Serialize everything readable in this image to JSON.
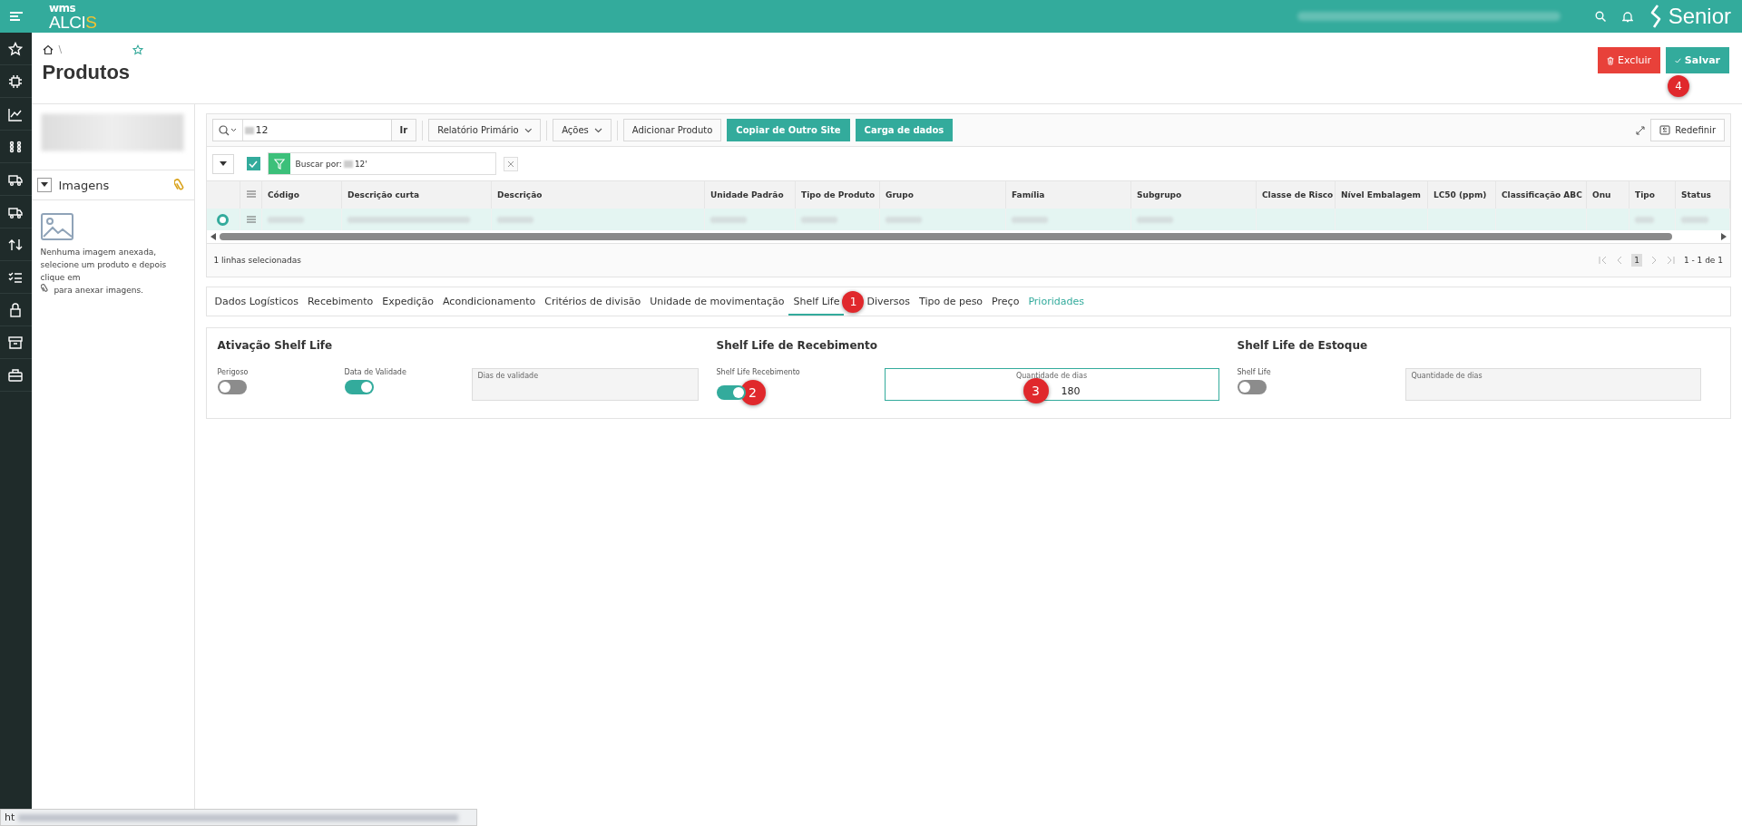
{
  "app": {
    "logo_top": "wms",
    "logo_main": "ALCI",
    "logo_accent": "S",
    "brand": "Senior"
  },
  "breadcrumb_separator": "\\",
  "page_title": "Produtos",
  "actions": [
    {
      "label": "Excluir",
      "kind": "delete"
    },
    {
      "label": "Salvar",
      "kind": "save",
      "callout": "4"
    }
  ],
  "images_panel": {
    "title": "Imagens",
    "expanded": true,
    "message_before": "Nenhuma imagem anexada, selecione um produto e depois clique em",
    "message_after": "para anexar imagens."
  },
  "toolbar": {
    "search_value": "12",
    "go": "Ir",
    "report": "Relatório Primário",
    "actions_menu": "Ações",
    "buttons": [
      {
        "label": "Adicionar Produto",
        "kind": "plain"
      },
      {
        "label": "Copiar de Outro Site",
        "kind": "primary"
      },
      {
        "label": "Carga de dados",
        "kind": "primary"
      }
    ],
    "reset": "Redefinir"
  },
  "filter": {
    "checked": true,
    "label": "Buscar por:",
    "value": "12'"
  },
  "table": {
    "columns": [
      "Código",
      "Descrição curta",
      "Descrição",
      "Unidade Padrão",
      "Tipo de Produto",
      "Grupo",
      "Família",
      "Subgrupo",
      "Classe de Risco",
      "Nível Embalagem",
      "LC50 (ppm)",
      "Classificação ABC",
      "Onu",
      "Tipo",
      "Status"
    ],
    "rows": [
      {
        "selected": true
      }
    ]
  },
  "selection_info": "1 linhas selecionadas",
  "pagination": {
    "page": "1",
    "range": "1 - 1 de 1"
  },
  "tabs": [
    {
      "label": "Dados Logísticos",
      "selected": false,
      "kind": "tab"
    },
    {
      "label": "Recebimento",
      "selected": false,
      "kind": "tab"
    },
    {
      "label": "Expedição",
      "selected": false,
      "kind": "tab"
    },
    {
      "label": "Acondicionamento",
      "selected": false,
      "kind": "tab"
    },
    {
      "label": "Critérios de divisão",
      "selected": false,
      "kind": "tab"
    },
    {
      "label": "Unidade de movimentação",
      "selected": false,
      "kind": "tab"
    },
    {
      "label": "Shelf Life",
      "selected": true,
      "kind": "tab",
      "callout": "1"
    },
    {
      "label": "Diversos",
      "selected": false,
      "kind": "tab"
    },
    {
      "label": "Tipo de peso",
      "selected": false,
      "kind": "tab"
    },
    {
      "label": "Preço",
      "selected": false,
      "kind": "tab"
    },
    {
      "label": "Prioridades",
      "selected": false,
      "kind": "link"
    }
  ],
  "sections": [
    {
      "title": "Ativação Shelf Life",
      "fields": [
        {
          "kind": "toggle",
          "label": "Perigoso",
          "on": false
        },
        {
          "kind": "toggle",
          "label": "Data de Validade",
          "on": true
        },
        {
          "kind": "input",
          "label": "Dias de validade",
          "disabled": true
        }
      ]
    },
    {
      "title": "Shelf Life de Recebimento",
      "fields": [
        {
          "kind": "toggle",
          "label": "Shelf Life Recebimento",
          "on": true,
          "callout": "2"
        },
        {
          "kind": "input",
          "label": "Quantidade de dias",
          "value": "180",
          "disabled": false,
          "callout": "3"
        }
      ]
    },
    {
      "title": "Shelf Life de Estoque",
      "fields": [
        {
          "kind": "toggle",
          "label": "Shelf Life",
          "on": false
        },
        {
          "kind": "input",
          "label": "Quantidade de dias",
          "disabled": true
        }
      ]
    }
  ],
  "status_bar": "ht"
}
